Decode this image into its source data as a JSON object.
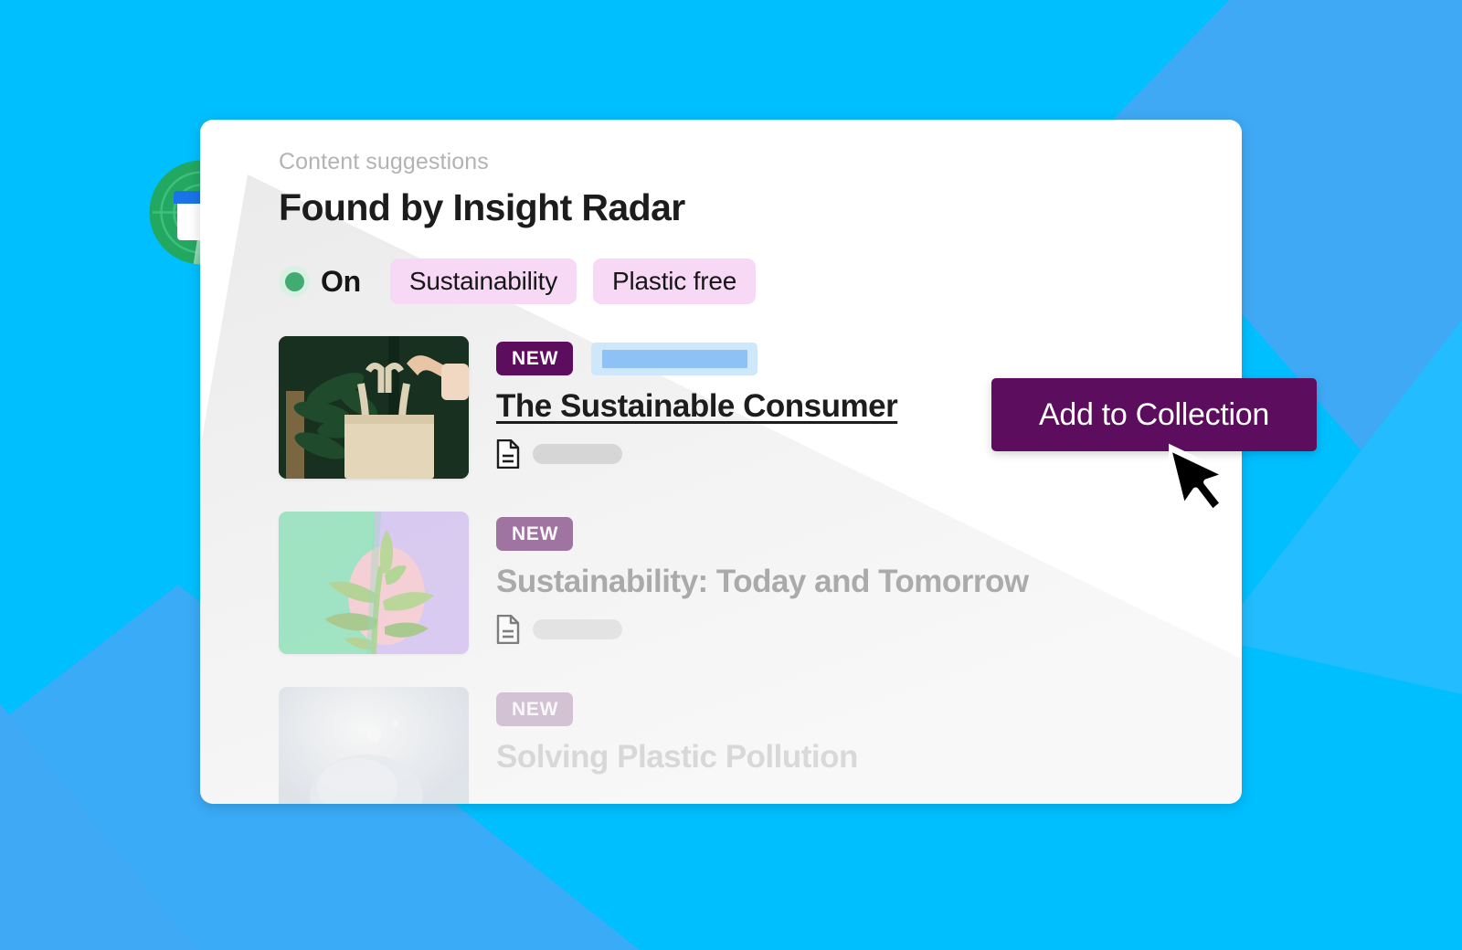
{
  "background": {
    "base_color": "#00BFFF",
    "accent_color": "#3FA9F5",
    "accent_color_light": "#29BFFF"
  },
  "logo": {
    "name": "insight-radar-logo",
    "ring_color": "#22A45D",
    "ring_color_dark": "#1E9B57",
    "doc_header_color": "#1A73E8",
    "doc_body_color": "#FFFFFF"
  },
  "card": {
    "eyebrow": "Content suggestions",
    "title": "Found by Insight Radar"
  },
  "toggle": {
    "state_label": "On",
    "dot_color": "#41AB72",
    "halo_color": "#DAF0E4",
    "chips": [
      {
        "label": "Sustainability"
      },
      {
        "label": "Plastic free"
      }
    ],
    "chip_bg": "#F7D8F5"
  },
  "suggestions": [
    {
      "badge": "NEW",
      "badge_color": "#5D0D5D",
      "title": "The Sustainable Consumer",
      "title_underlined": true,
      "has_blue_skeleton": true,
      "has_doc_icon": true,
      "has_grey_skeleton": true,
      "thumbnail": "tote-bag-photo",
      "opacity_class": ""
    },
    {
      "badge": "NEW",
      "badge_color": "#5D0D5D",
      "title": "Sustainability: Today and Tomorrow",
      "title_underlined": false,
      "has_blue_skeleton": false,
      "has_doc_icon": true,
      "has_grey_skeleton": true,
      "thumbnail": "plant-illustration",
      "opacity_class": "faded-1"
    },
    {
      "badge": "NEW",
      "badge_color": "#5D0D5D",
      "title": "Solving Plastic Pollution",
      "title_underlined": false,
      "has_blue_skeleton": false,
      "has_doc_icon": false,
      "has_grey_skeleton": false,
      "thumbnail": "plastic-water-photo",
      "opacity_class": "faded-2"
    }
  ],
  "cta": {
    "label": "Add to Collection",
    "bg_color": "#5D0D5D",
    "text_color": "#FFFFFF"
  },
  "cursor": {
    "name": "mouse-pointer"
  }
}
